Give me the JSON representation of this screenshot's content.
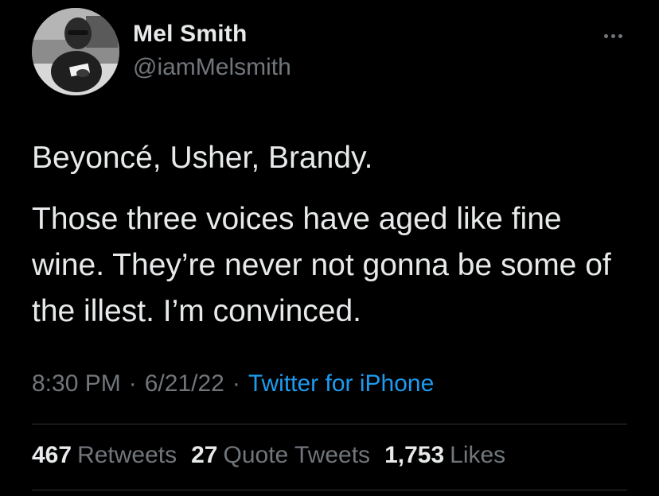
{
  "author": {
    "name": "Mel Smith",
    "handle": "@iamMelsmith"
  },
  "tweet": {
    "paragraphs": [
      "Beyoncé, Usher, Brandy.",
      "Those three voices have aged like fine wine. They’re never not gonna be some of the illest. I’m convinced."
    ]
  },
  "meta": {
    "time": "8:30 PM",
    "separator": "·",
    "date": "6/21/22",
    "source": "Twitter for iPhone"
  },
  "stats": {
    "retweets": {
      "count": "467",
      "label": "Retweets"
    },
    "quote_tweets": {
      "count": "27",
      "label": "Quote Tweets"
    },
    "likes": {
      "count": "1,753",
      "label": "Likes"
    }
  },
  "icons": {
    "more": "more-options-icon"
  },
  "colors": {
    "background": "#000000",
    "primary_text": "#e7e9ea",
    "secondary_text": "#71767b",
    "link": "#1d9bf0",
    "divider": "#2f3336"
  }
}
